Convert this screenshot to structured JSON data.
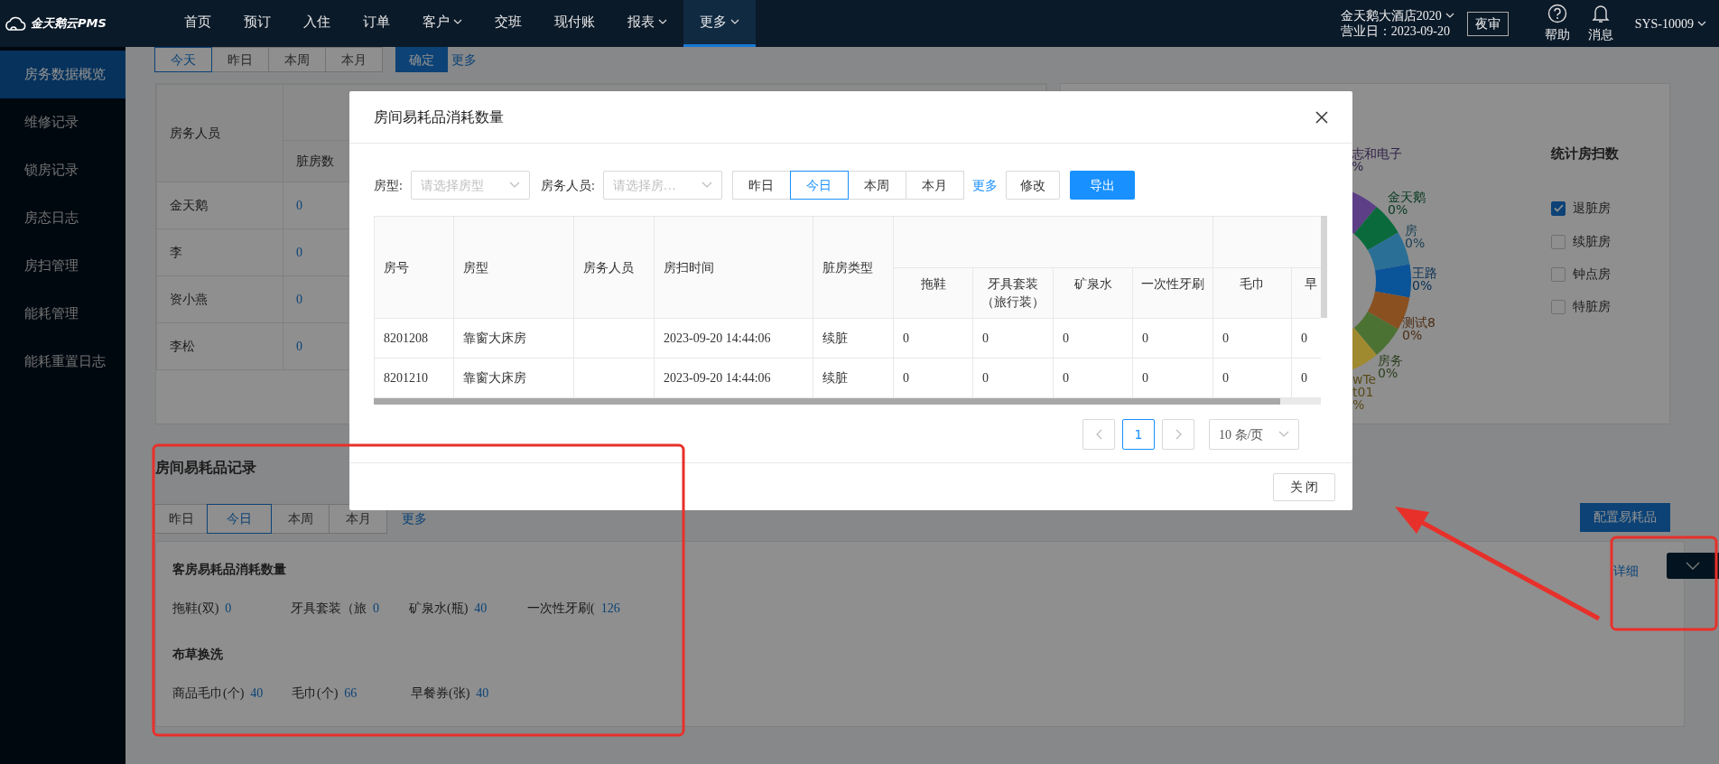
{
  "header": {
    "logo": "金天鹅云PMS",
    "menu": [
      {
        "label": "首页",
        "dropdown": false,
        "selected": false
      },
      {
        "label": "预订",
        "dropdown": false,
        "selected": false
      },
      {
        "label": "入住",
        "dropdown": false,
        "selected": false
      },
      {
        "label": "订单",
        "dropdown": false,
        "selected": false
      },
      {
        "label": "客户",
        "dropdown": true,
        "selected": false
      },
      {
        "label": "交班",
        "dropdown": false,
        "selected": false
      },
      {
        "label": "现付账",
        "dropdown": false,
        "selected": false
      },
      {
        "label": "报表",
        "dropdown": true,
        "selected": false
      },
      {
        "label": "更多",
        "dropdown": true,
        "selected": true
      }
    ],
    "hotel": "金天鹅大酒店2020",
    "business_date": "营业日：2023-09-20",
    "night_audit": "夜审",
    "help": "帮助",
    "messages": "消息",
    "user": "SYS-10009"
  },
  "sidebar": [
    {
      "label": "房务数据概览",
      "selected": true
    },
    {
      "label": "维修记录",
      "selected": false
    },
    {
      "label": "锁房记录",
      "selected": false
    },
    {
      "label": "房态日志",
      "selected": false
    },
    {
      "label": "房扫管理",
      "selected": false
    },
    {
      "label": "能耗管理",
      "selected": false
    },
    {
      "label": "能耗重置日志",
      "selected": false
    }
  ],
  "overview": {
    "tabs": [
      {
        "label": "今天",
        "selected": true
      },
      {
        "label": "昨日",
        "selected": false
      },
      {
        "label": "本周",
        "selected": false
      },
      {
        "label": "本月",
        "selected": false
      }
    ],
    "confirm": "确定",
    "more": "更多",
    "staff_table": {
      "columns": [
        "房务人员",
        "脏房数"
      ],
      "rows": [
        {
          "name": "金天鹅",
          "dirty": "0"
        },
        {
          "name": "李",
          "dirty": "0"
        },
        {
          "name": "资小燕",
          "dirty": "0"
        },
        {
          "name": "李松",
          "dirty": "0"
        }
      ]
    },
    "donut": {
      "segments": [
        {
          "lines": [
            "志和电子",
            "%"
          ],
          "color": "#5c3f86"
        },
        {
          "lines": [
            "金天鹅",
            "0%"
          ],
          "color": "#0a6a3c"
        },
        {
          "lines": [
            "房",
            "0%"
          ],
          "color": "#2a6f96"
        },
        {
          "lines": [
            "王路",
            "0%"
          ],
          "color": "#0a5499"
        },
        {
          "lines": [
            "测试8",
            "0%"
          ],
          "color": "#8a5020"
        },
        {
          "lines": [
            "房务",
            "0%"
          ],
          "color": "#4c7233"
        },
        {
          "lines": [
            "wTe",
            "t01",
            "%"
          ],
          "color": "#a08a30"
        }
      ]
    },
    "room_count": {
      "title": "统计房扫数",
      "options": [
        {
          "label": "退脏房",
          "checked": true
        },
        {
          "label": "续脏房",
          "checked": false
        },
        {
          "label": "钟点房",
          "checked": false
        },
        {
          "label": "特脏房",
          "checked": false
        }
      ]
    }
  },
  "consumables": {
    "title": "房间易耗品记录",
    "tabs": [
      {
        "label": "昨日",
        "selected": false
      },
      {
        "label": "今日",
        "selected": true
      },
      {
        "label": "本周",
        "selected": false
      },
      {
        "label": "本月",
        "selected": false
      }
    ],
    "more": "更多",
    "config_button": "配置易耗品",
    "detail_link": "详细",
    "groups": [
      {
        "title": "客房易耗品消耗数量",
        "items": [
          {
            "label": "拖鞋(双)",
            "value": "0"
          },
          {
            "label": "牙具套装（旅",
            "value": "0"
          },
          {
            "label": "矿泉水(瓶)",
            "value": "40"
          },
          {
            "label": "一次性牙刷(",
            "value": "126"
          }
        ]
      },
      {
        "title": "布草换洗",
        "items": [
          {
            "label": "商品毛巾(个)",
            "value": "40"
          },
          {
            "label": "毛巾(个)",
            "value": "66"
          },
          {
            "label": "早餐券(张)",
            "value": "40"
          }
        ]
      }
    ]
  },
  "modal": {
    "title": "房间易耗品消耗数量",
    "filters": [
      {
        "label": "房型:",
        "placeholder": "请选择房型"
      },
      {
        "label": "房务人员:",
        "placeholder": "请选择房…"
      }
    ],
    "tabs": [
      {
        "label": "昨日",
        "selected": false
      },
      {
        "label": "今日",
        "selected": true
      },
      {
        "label": "本周",
        "selected": false
      },
      {
        "label": "本月",
        "selected": false
      }
    ],
    "more": "更多",
    "edit": "修改",
    "export": "导出",
    "table": {
      "columns": [
        "房号",
        "房型",
        "房务人员",
        "房扫时间",
        "脏房类型"
      ],
      "column_groups": [
        {
          "columns": [
            "拖鞋",
            "牙具套装（旅行装）",
            "矿泉水",
            "一次性牙刷"
          ]
        },
        {
          "columns": [
            "毛巾",
            "早"
          ]
        }
      ],
      "rows": [
        {
          "room": "8201208",
          "type": "靠窗大床房",
          "time": "2023-09-20 14:44:06",
          "dirty_type": "续脏",
          "values": [
            "0",
            "0",
            "0",
            "0",
            "0",
            "0"
          ]
        },
        {
          "room": "8201210",
          "type": "靠窗大床房",
          "time": "2023-09-20 14:44:06",
          "dirty_type": "续脏",
          "values": [
            "0",
            "0",
            "0",
            "0",
            "0",
            "0"
          ]
        }
      ]
    },
    "pagination": {
      "pages": [
        {
          "label": "1",
          "selected": true
        }
      ],
      "page_size": "10 条/页"
    },
    "close": "关 闭"
  }
}
